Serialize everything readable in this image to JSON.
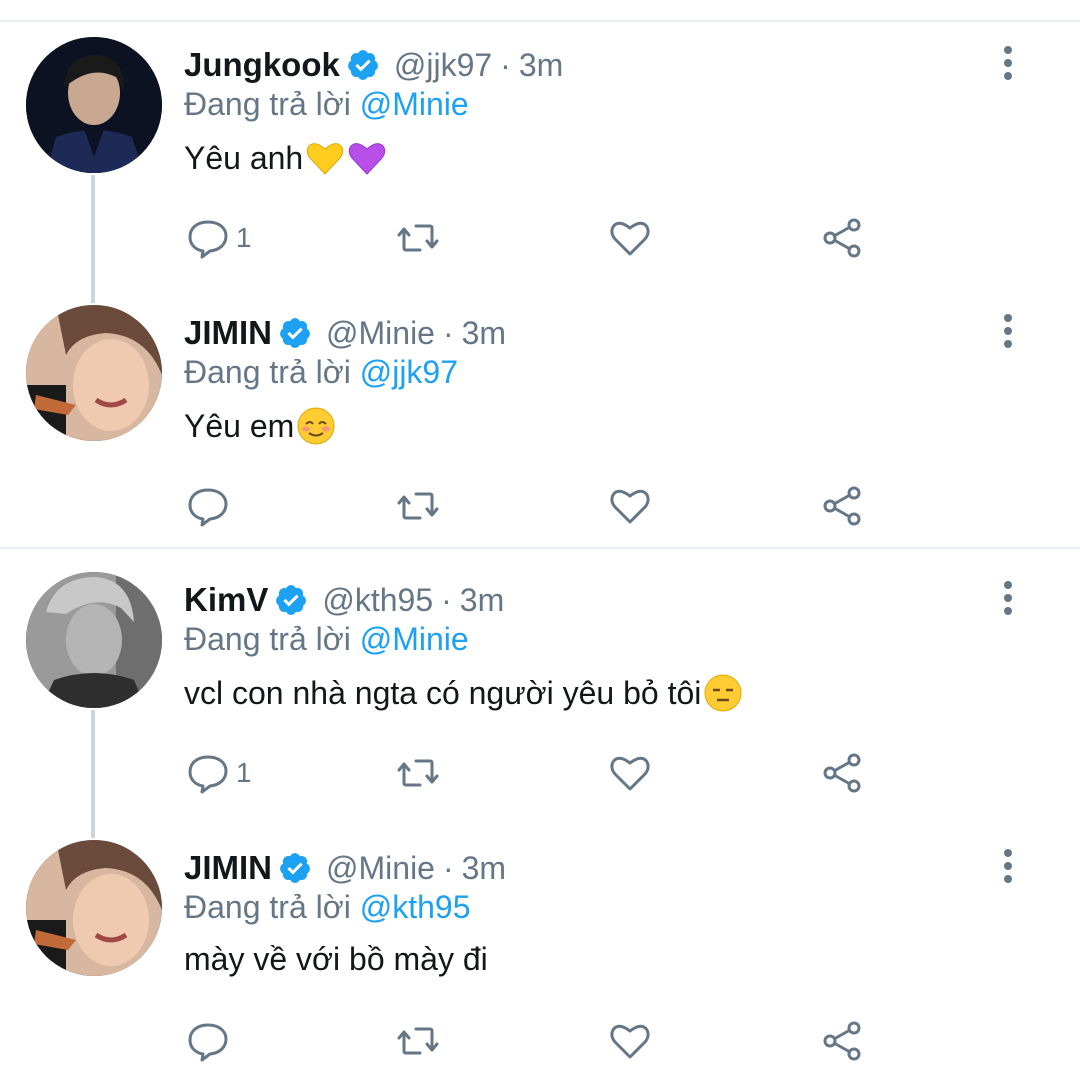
{
  "tweets": [
    {
      "name": "Jungkook",
      "handle": "@jjk97",
      "time": "3m",
      "reply_prefix": "Đang trả lời",
      "reply_to": "@Minie",
      "text": "Yêu anh",
      "emojis": [
        "yellow-heart",
        "purple-heart"
      ],
      "reply_count": "1",
      "avatar": "avatar-jungkook"
    },
    {
      "name": "JIMIN",
      "handle": "@Minie",
      "time": "3m",
      "reply_prefix": "Đang trả lời",
      "reply_to": "@jjk97",
      "text": "Yêu em",
      "emojis": [
        "relieved-face"
      ],
      "reply_count": "",
      "avatar": "avatar-jimin"
    },
    {
      "name": "KimV",
      "handle": "@kth95",
      "time": "3m",
      "reply_prefix": "Đang trả lời",
      "reply_to": "@Minie",
      "text": "vcl con nhà ngta có người yêu bỏ tôi",
      "emojis": [
        "expressionless-face"
      ],
      "reply_count": "1",
      "avatar": "avatar-kimv"
    },
    {
      "name": "JIMIN",
      "handle": "@Minie",
      "time": "3m",
      "reply_prefix": "Đang trả lời",
      "reply_to": "@kth95",
      "text": "mày về với bồ mày đi",
      "emojis": [],
      "reply_count": "",
      "avatar": "avatar-jimin"
    }
  ],
  "colors": {
    "link": "#1da1f2",
    "secondary_text": "#657786",
    "primary_text": "#14171a",
    "divider": "#e6ecf0",
    "thread_line": "#ccd6dd"
  },
  "icons": [
    "reply-icon",
    "retweet-icon",
    "like-icon",
    "share-icon",
    "more-icon",
    "verified-badge-icon"
  ]
}
